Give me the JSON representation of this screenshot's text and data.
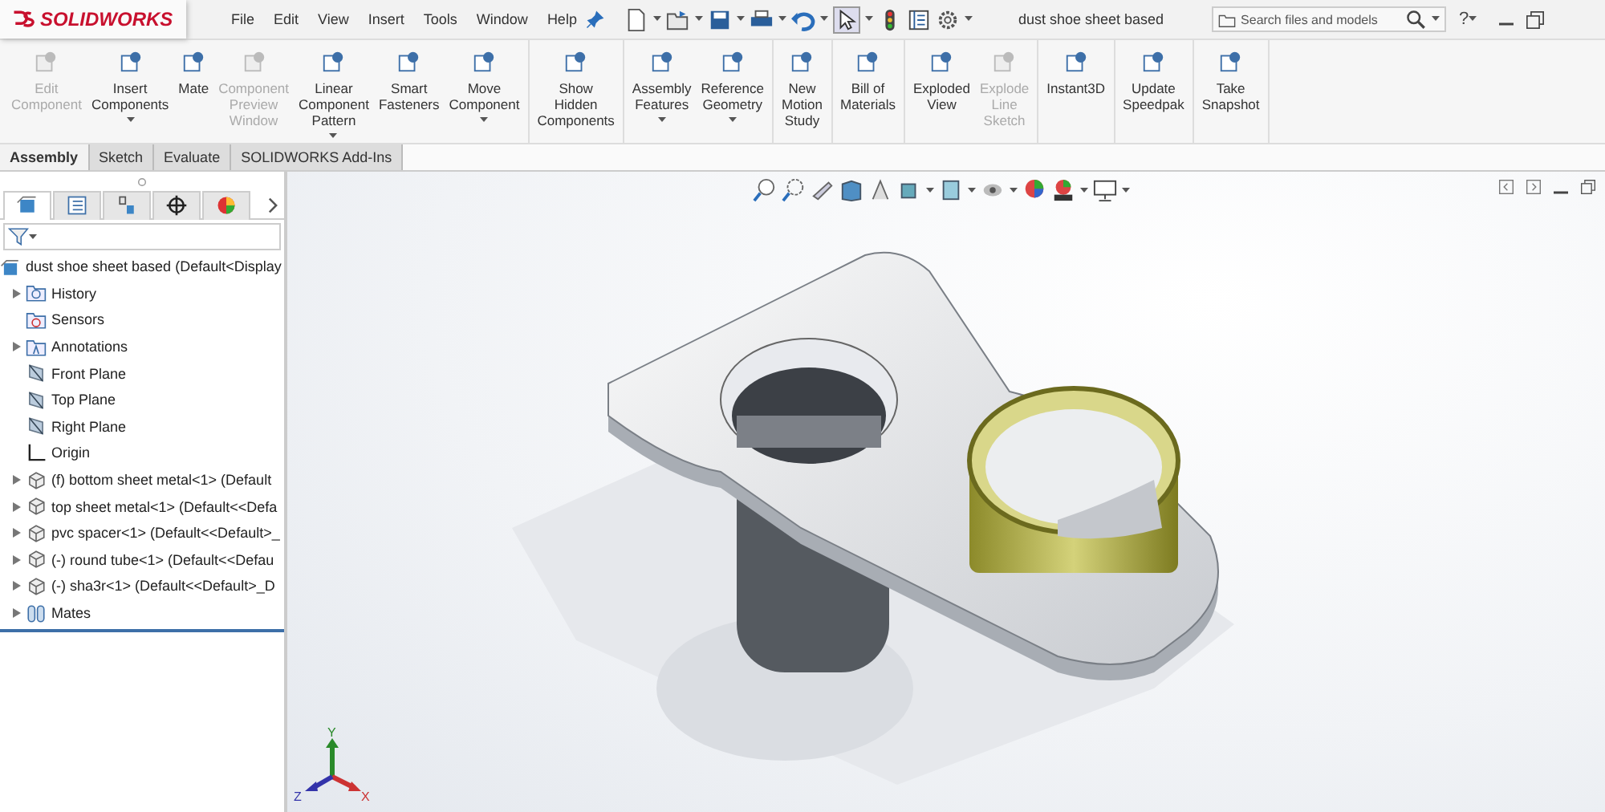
{
  "app": {
    "logo": "SOLIDWORKS"
  },
  "menu": [
    "File",
    "Edit",
    "View",
    "Insert",
    "Tools",
    "Window",
    "Help"
  ],
  "document_title": "dust shoe sheet based",
  "search": {
    "placeholder": "Search files and models"
  },
  "help": "?",
  "ribbon": [
    {
      "buttons": [
        {
          "label": "Edit\nComponent",
          "disabled": true,
          "dropdown": false
        },
        {
          "label": "Insert\nComponents",
          "disabled": false,
          "dropdown": true
        },
        {
          "label": "Mate",
          "disabled": false,
          "dropdown": false
        },
        {
          "label": "Component\nPreview\nWindow",
          "disabled": true,
          "dropdown": false
        },
        {
          "label": "Linear\nComponent\nPattern",
          "disabled": false,
          "dropdown": true
        },
        {
          "label": "Smart\nFasteners",
          "disabled": false,
          "dropdown": false
        },
        {
          "label": "Move\nComponent",
          "disabled": false,
          "dropdown": true
        }
      ]
    },
    {
      "buttons": [
        {
          "label": "Show\nHidden\nComponents",
          "disabled": false,
          "dropdown": false
        }
      ]
    },
    {
      "buttons": [
        {
          "label": "Assembly\nFeatures",
          "disabled": false,
          "dropdown": true
        },
        {
          "label": "Reference\nGeometry",
          "disabled": false,
          "dropdown": true
        }
      ]
    },
    {
      "buttons": [
        {
          "label": "New\nMotion\nStudy",
          "disabled": false,
          "dropdown": false
        }
      ]
    },
    {
      "buttons": [
        {
          "label": "Bill of\nMaterials",
          "disabled": false,
          "dropdown": false
        }
      ]
    },
    {
      "buttons": [
        {
          "label": "Exploded\nView",
          "disabled": false,
          "dropdown": false
        },
        {
          "label": "Explode\nLine\nSketch",
          "disabled": true,
          "dropdown": false
        }
      ]
    },
    {
      "buttons": [
        {
          "label": "Instant3D",
          "disabled": false,
          "dropdown": false
        }
      ]
    },
    {
      "buttons": [
        {
          "label": "Update\nSpeedpak",
          "disabled": false,
          "dropdown": false
        }
      ]
    },
    {
      "buttons": [
        {
          "label": "Take\nSnapshot",
          "disabled": false,
          "dropdown": false
        }
      ]
    }
  ],
  "tabs": [
    {
      "label": "Assembly",
      "selected": true
    },
    {
      "label": "Sketch",
      "selected": false
    },
    {
      "label": "Evaluate",
      "selected": false
    },
    {
      "label": "SOLIDWORKS Add-Ins",
      "selected": false
    }
  ],
  "panel_tabs": [
    {
      "selected": true
    },
    {
      "selected": false
    },
    {
      "selected": false
    },
    {
      "selected": false
    },
    {
      "selected": false
    }
  ],
  "tree": {
    "label": "dust shoe sheet based  (Default<Display",
    "children": [
      {
        "label": "History",
        "kind": "history",
        "expanded": false
      },
      {
        "label": "Sensors",
        "kind": "sensors"
      },
      {
        "label": "Annotations",
        "kind": "annotations",
        "expanded": false
      },
      {
        "label": "Front Plane",
        "kind": "plane"
      },
      {
        "label": "Top Plane",
        "kind": "plane"
      },
      {
        "label": "Right Plane",
        "kind": "plane"
      },
      {
        "label": "Origin",
        "kind": "origin"
      },
      {
        "label": "(f) bottom sheet metal<1> (Default",
        "kind": "part",
        "expanded": false
      },
      {
        "label": "top sheet metal<1> (Default<<Defa",
        "kind": "part",
        "expanded": false
      },
      {
        "label": "pvc spacer<1> (Default<<Default>_",
        "kind": "part",
        "expanded": false
      },
      {
        "label": "(-) round tube<1> (Default<<Defau",
        "kind": "part",
        "expanded": false
      },
      {
        "label": "(-) sha3r<1> (Default<<Default>_D",
        "kind": "part",
        "expanded": false
      },
      {
        "label": "Mates",
        "kind": "mates",
        "expanded": false
      }
    ]
  },
  "triad": {
    "x": "X",
    "y": "Y",
    "z": "Z"
  }
}
